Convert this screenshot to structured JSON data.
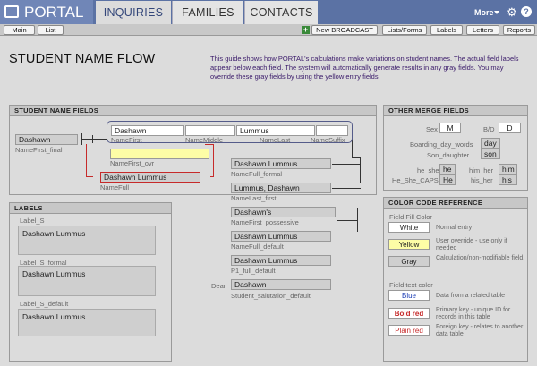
{
  "header": {
    "logo": "PORTAL",
    "tabs": [
      {
        "label": "INQUIRIES"
      },
      {
        "label": "FAMILIES"
      },
      {
        "label": "CONTACTS"
      }
    ],
    "more": "More"
  },
  "toolbar": {
    "main": "Main",
    "list": "List",
    "new_broadcast": "New BROADCAST",
    "lists_forms": "Lists/Forms",
    "labels": "Labels",
    "letters": "Letters",
    "reports": "Reports"
  },
  "page": {
    "title": "STUDENT NAME FLOW",
    "guide": "This guide shows how PORTAL's calculations make variations on student names. The actual field labels appear below each field. The system will automatically generate results in any gray fields. You may override these gray fields by using the yellow entry fields."
  },
  "student_name_fields": {
    "header": "STUDENT NAME FIELDS",
    "name_first_final": {
      "value": "Dashawn",
      "label": "NameFirst_final"
    },
    "name_first": {
      "value": "Dashawn",
      "label": "NameFirst"
    },
    "name_middle": {
      "value": "",
      "label": "NameMiddle"
    },
    "name_last": {
      "value": "Lummus",
      "label": "NameLast"
    },
    "name_suffix": {
      "value": "",
      "label": "NameSuffix"
    },
    "name_first_ovr": {
      "value": "",
      "label": "NameFirst_ovr"
    },
    "name_full": {
      "value": "Dashawn Lummus",
      "label": "NameFull"
    },
    "name_full_formal": {
      "value": "Dashawn Lummus",
      "label": "NameFull_formal"
    },
    "name_last_first": {
      "value": "Lummus, Dashawn",
      "label": "NameLast_first"
    },
    "name_first_possessive": {
      "value": "Dashawn's",
      "label": "NameFirst_possessive"
    },
    "name_full_default": {
      "value": "Dashawn Lummus",
      "label": "NameFull_default"
    },
    "p1_full_default": {
      "value": "Dashawn Lummus",
      "label": "P1_full_default"
    },
    "salutation": {
      "prefix": "Dear",
      "value": "Dashawn",
      "label": "Student_salutation_default"
    }
  },
  "labels_panel": {
    "header": "LABELS",
    "items": [
      {
        "label": "Label_S",
        "value": "Dashawn Lummus"
      },
      {
        "label": "Label_S_formal",
        "value": "Dashawn Lummus"
      },
      {
        "label": "Label_S_default",
        "value": "Dashawn Lummus"
      }
    ]
  },
  "other_merge": {
    "header": "OTHER MERGE FIELDS",
    "sex": {
      "label": "Sex",
      "value": "M"
    },
    "bd": {
      "label": "B/D",
      "value": "D"
    },
    "boarding_day_words": {
      "label": "Boarding_day_words",
      "value": "day"
    },
    "son_daughter": {
      "label": "Son_daughter",
      "value": "son"
    },
    "he_she": {
      "label": "he_she",
      "value": "he"
    },
    "he_she_caps": {
      "label": "He_She_CAPS",
      "value": "He"
    },
    "him_her": {
      "label": "him_her",
      "value": "him"
    },
    "his_her": {
      "label": "his_her",
      "value": "his"
    }
  },
  "color_code": {
    "header": "COLOR CODE REFERENCE",
    "fill_title": "Field Fill Color",
    "white": {
      "label": "White",
      "note": "Normal entry"
    },
    "yellow": {
      "label": "Yellow",
      "note": "User override - use only if needed"
    },
    "gray": {
      "label": "Gray",
      "note": "Calculation/non-modifiable field."
    },
    "text_title": "Field text color",
    "blue": {
      "label": "Blue",
      "note": "Data from a related table"
    },
    "bold_red": {
      "label": "Bold red",
      "note": "Primary key - unique ID for records in this table"
    },
    "plain_red": {
      "label": "Plain red",
      "note": "Foreign key - relates to another data table"
    }
  },
  "colors": {
    "header_blue": "#5b72a4",
    "accent_link": "#55469a",
    "red": "#c62a2a",
    "blue_text": "#1e3fb5"
  }
}
